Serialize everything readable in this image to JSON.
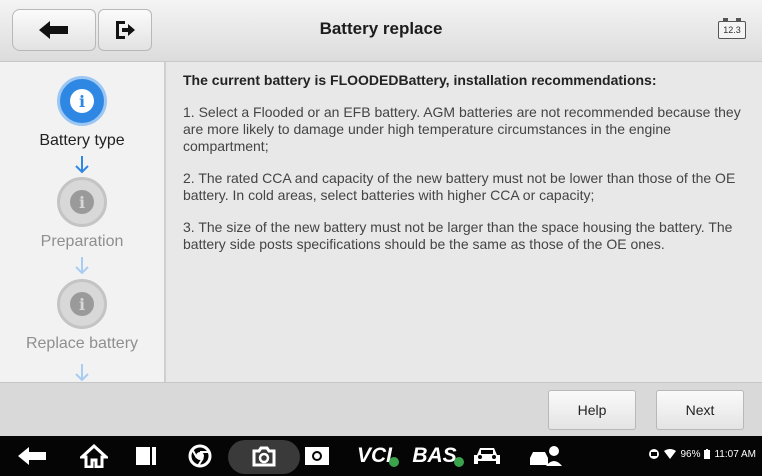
{
  "header": {
    "title": "Battery replace",
    "battery_badge": "12.3"
  },
  "steps": [
    {
      "label": "Battery type",
      "state": "active"
    },
    {
      "label": "Preparation",
      "state": "inactive"
    },
    {
      "label": "Replace battery",
      "state": "inactive"
    }
  ],
  "content": {
    "heading": "The current battery is FLOODEDBattery, installation recommendations:",
    "paragraphs": [
      "1. Select a Flooded or an EFB battery. AGM batteries are not recommended because they are more likely to damage under high temperature circumstances in the engine compartment;",
      "2. The rated CCA and capacity of the new battery must not be lower than those of the OE battery. In cold areas, select batteries with higher CCA or capacity;",
      "3. The size of the new battery must not be larger than the space housing the battery. The battery side posts specifications should be the same as those of the OE ones."
    ]
  },
  "footer": {
    "help_label": "Help",
    "next_label": "Next"
  },
  "navbar": {
    "vci_label": "VCI",
    "bas_label": "BAS",
    "status": {
      "battery_percent": "96%",
      "time": "11:07 AM"
    }
  },
  "colors": {
    "accent": "#2f87e4",
    "inactive_step": "#9a9a9a",
    "badge_green": "#3ca34d"
  }
}
